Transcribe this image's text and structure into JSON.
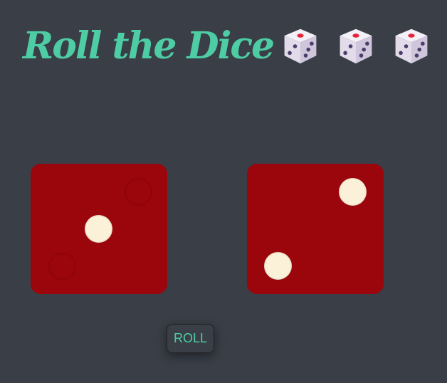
{
  "header": {
    "title": "Roll the Dice",
    "title_icons": [
      "dice-emoji-icon",
      "dice-emoji-icon",
      "dice-emoji-icon"
    ]
  },
  "dice": [
    {
      "name": "left-die",
      "face_value": 1,
      "color": "#9b050c"
    },
    {
      "name": "right-die",
      "face_value": 2,
      "color": "#9b050c"
    }
  ],
  "controls": {
    "roll_label": "ROLL"
  },
  "colors": {
    "background": "#393e47",
    "accent": "#4ecca3",
    "die": "#9b050c",
    "pip": "#fbf1d8"
  }
}
